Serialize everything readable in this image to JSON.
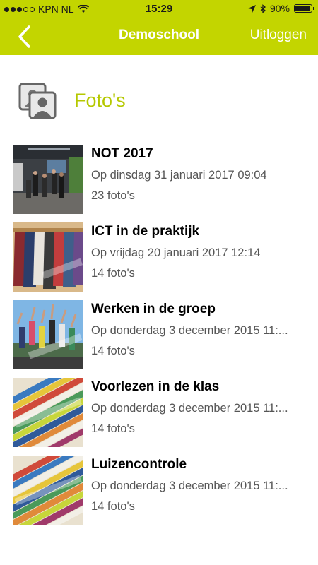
{
  "status_bar": {
    "carrier": "KPN NL",
    "time": "15:29",
    "battery": "90%",
    "battery_level": 0.9,
    "icons": [
      "signal-dots",
      "wifi-icon",
      "location-arrow-icon",
      "bluetooth-icon",
      "battery-icon"
    ]
  },
  "nav": {
    "back_icon": "chevron-left-icon",
    "title": "Demoschool",
    "logout_label": "Uitloggen"
  },
  "section": {
    "icon": "photo-album-icon",
    "title": "Foto's"
  },
  "colors": {
    "accent": "#c3d500",
    "title_accent": "#b5c800",
    "text_secondary": "#555555"
  },
  "albums": [
    {
      "title": "NOT 2017",
      "date": "Op dinsdag 31 januari 2017 09:04",
      "count": "23 foto's",
      "thumbnail": "exhibition-hall-photo"
    },
    {
      "title": "ICT in de praktijk",
      "date": "Op vrijdag 20 januari 2017 12:14",
      "count": "14 foto's",
      "thumbnail": "coat-rack-photo"
    },
    {
      "title": "Werken in de groep",
      "date": "Op donderdag 3 december 2015 11:...",
      "count": "14 foto's",
      "thumbnail": "jumping-group-photo"
    },
    {
      "title": "Voorlezen in de klas",
      "date": "Op donderdag 3 december 2015 11:...",
      "count": "14 foto's",
      "thumbnail": "stacked-books-photo"
    },
    {
      "title": "Luizencontrole",
      "date": "Op donderdag 3 december 2015 11:...",
      "count": "14 foto's",
      "thumbnail": "stacked-books-photo"
    }
  ]
}
